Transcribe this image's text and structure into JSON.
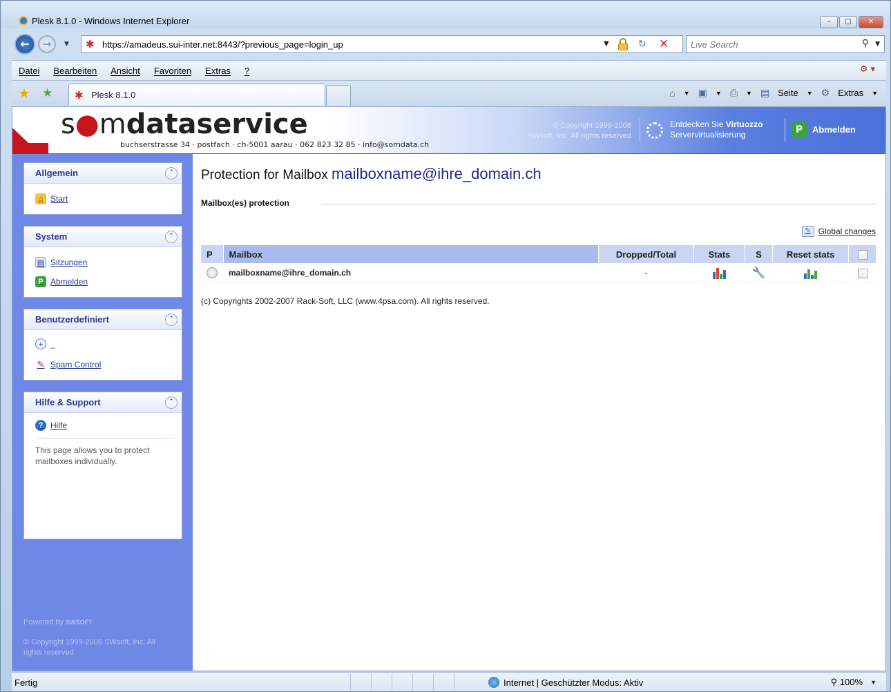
{
  "window": {
    "title": "Plesk 8.1.0 - Windows Internet Explorer",
    "address": "https://amadeus.sui-inter.net:8443/?previous_page=login_up",
    "search_placeholder": "Live Search",
    "menu": [
      "Datei",
      "Bearbeiten",
      "Ansicht",
      "Favoriten",
      "Extras",
      "?"
    ],
    "tab_label": "Plesk 8.1.0",
    "command_seite": "Seite",
    "command_extras": "Extras",
    "status_left": "Fertig",
    "status_zone": "Internet | Geschützter Modus: Aktiv",
    "zoom": "100%"
  },
  "header": {
    "logo_prefix": "s",
    "logo_dot": "●",
    "logo_m": "m",
    "logo_bold": "dataservice",
    "logo_sub": "buchserstrasse 34 · postfach · ch-5001 aarau · 062 823 32 85 · info@somdata.ch",
    "copyright_line1": "© Copyright 1999-2006",
    "copyright_line2": "SWsoft, Inc. All rights reserved",
    "virtuozzo_line1_prefix": "Entdecken Sie ",
    "virtuozzo_line1_bold": "Virtuozzo",
    "virtuozzo_line2": "Servervirtualisierung",
    "logout_label": "Abmelden"
  },
  "sidebar": {
    "allgemein": {
      "title": "Allgemein",
      "items": [
        "Start"
      ]
    },
    "system": {
      "title": "System",
      "items": [
        "Sitzungen",
        "Abmelden"
      ]
    },
    "custom": {
      "title": "Benutzerdefiniert",
      "items": [
        "_",
        "Spam Control"
      ]
    },
    "help": {
      "title": "Hilfe & Support",
      "link": "Hilfe",
      "text": "This page allows you to protect mailboxes individually."
    },
    "powered_by": "Powered by",
    "powered_brand": "SWSOFT",
    "copyright": "© Copyright 1999-2006 SWsoft, Inc. All rights reserved"
  },
  "main": {
    "title_prefix": "Protection for Mailbox ",
    "title_mailbox": "mailboxname@ihre_domain.ch",
    "section": "Mailbox(es) protection",
    "global_changes": "Global changes",
    "columns": [
      "P",
      "Mailbox",
      "Dropped/Total",
      "Stats",
      "S",
      "Reset stats"
    ],
    "rows": [
      {
        "mailbox": "mailboxname@ihre_domain.ch",
        "dropped_total": "-"
      }
    ],
    "footer": "(c) Copyrights 2002-2007 Rack-Soft, LLC (www.4psa.com). All rights reserved."
  },
  "colors": {
    "sidebar_bg": "#7088e5",
    "header_accent": "#4a70da",
    "logo_red": "#c4161c",
    "link": "#2b3a8f"
  }
}
